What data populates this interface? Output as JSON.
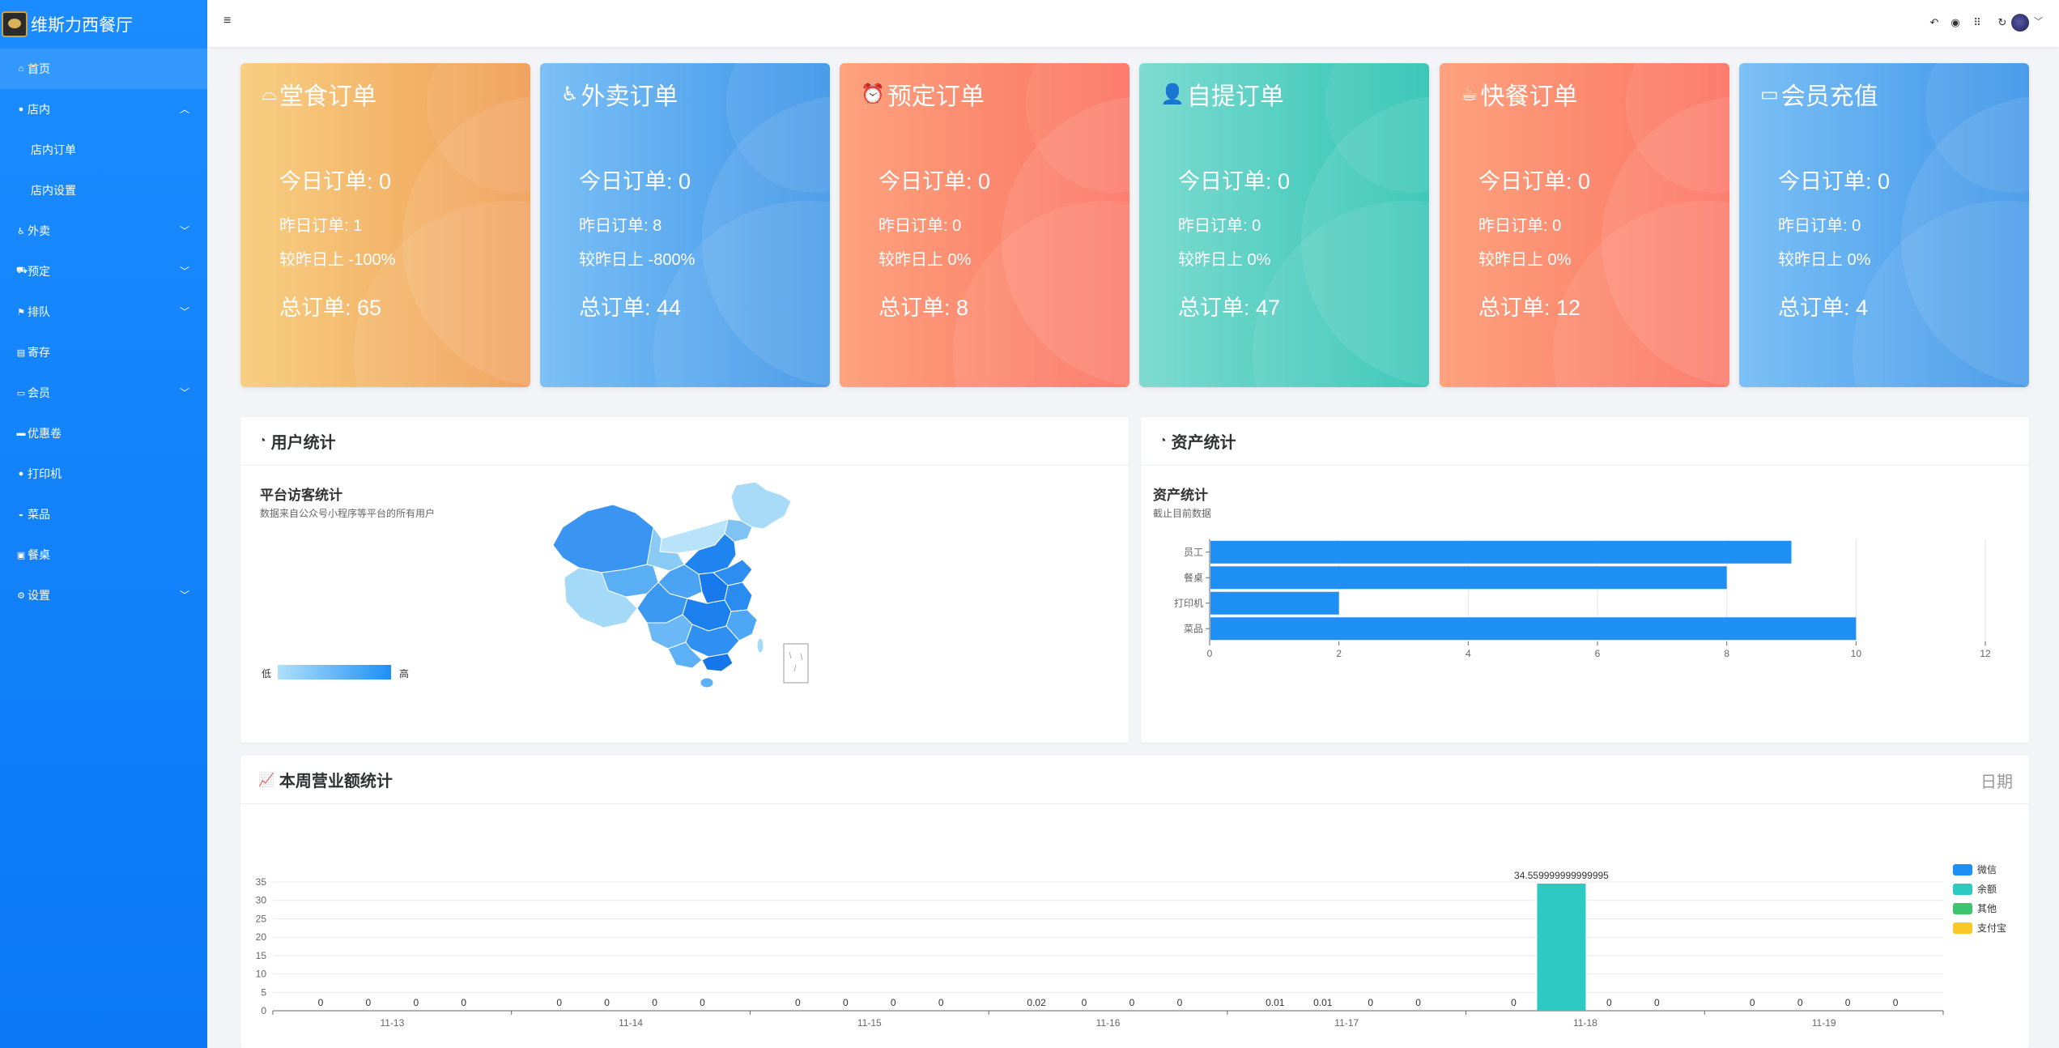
{
  "brand": {
    "title": "维斯力西餐厅"
  },
  "sidebar": {
    "items": [
      {
        "label": "首页",
        "icon": "home-icon",
        "glyph": "⌂",
        "active": true,
        "chev": "",
        "name": "home"
      },
      {
        "label": "店内",
        "icon": "user-icon",
        "glyph": "●",
        "chev": "︿",
        "name": "in-store"
      },
      {
        "label": "店内订单",
        "sub": true,
        "name": "in-store-orders"
      },
      {
        "label": "店内设置",
        "sub": true,
        "name": "in-store-settings"
      },
      {
        "label": "外卖",
        "icon": "bike-icon",
        "glyph": "♿",
        "chev": "﹀",
        "name": "takeout"
      },
      {
        "label": "预定",
        "icon": "cart-icon",
        "glyph": "⛟",
        "chev": "﹀",
        "name": "reserve"
      },
      {
        "label": "排队",
        "icon": "queue-icon",
        "glyph": "⚑",
        "chev": "﹀",
        "name": "queue"
      },
      {
        "label": "寄存",
        "icon": "storage-icon",
        "glyph": "▤",
        "chev": "",
        "name": "storage"
      },
      {
        "label": "会员",
        "icon": "card-icon",
        "glyph": "▭",
        "chev": "﹀",
        "name": "member"
      },
      {
        "label": "优惠卷",
        "icon": "coupon-icon",
        "glyph": "▬",
        "chev": "",
        "name": "coupon"
      },
      {
        "label": "打印机",
        "icon": "printer-icon",
        "glyph": "●",
        "chev": "",
        "name": "printer"
      },
      {
        "label": "菜品",
        "icon": "dish-icon",
        "glyph": "◒",
        "chev": "",
        "name": "dishes"
      },
      {
        "label": "餐桌",
        "icon": "table-icon",
        "glyph": "▣",
        "chev": "",
        "name": "tables"
      },
      {
        "label": "设置",
        "icon": "gear-icon",
        "glyph": "⚙",
        "chev": "﹀",
        "name": "settings"
      }
    ]
  },
  "topbar": {
    "menu_icon": "≡",
    "icons": [
      {
        "name": "back-icon",
        "glyph": "↶"
      },
      {
        "name": "theme-icon",
        "glyph": "◉"
      },
      {
        "name": "apps-icon",
        "glyph": "⠿"
      },
      {
        "name": "refresh-icon",
        "glyph": "↻"
      }
    ],
    "avatar_caret": "﹀"
  },
  "cards": [
    {
      "title": "堂食订单",
      "icon": "dine-in-icon",
      "glyph": "⌓",
      "today": "今日订单: 0",
      "yesterday": "昨日订单: 1",
      "compare": "较昨日上 -100%",
      "total": "总订单: 65",
      "color_from": "#f7cf82",
      "color_to": "#f09d55"
    },
    {
      "title": "外卖订单",
      "icon": "bike-icon",
      "glyph": "♿",
      "today": "今日订单: 0",
      "yesterday": "昨日订单: 8",
      "compare": "较昨日上 -800%",
      "total": "总订单: 44",
      "color_from": "#7cc0f6",
      "color_to": "#3d95e8"
    },
    {
      "title": "预定订单",
      "icon": "alarm-icon",
      "glyph": "⏰",
      "today": "今日订单: 0",
      "yesterday": "昨日订单: 0",
      "compare": "较昨日上 0%",
      "total": "总订单: 8",
      "color_from": "#fda27e",
      "color_to": "#fc7362"
    },
    {
      "title": "自提订单",
      "icon": "person-icon",
      "glyph": "👤",
      "today": "今日订单: 0",
      "yesterday": "昨日订单: 0",
      "compare": "较昨日上 0%",
      "total": "总订单: 47",
      "color_from": "#7fdbd1",
      "color_to": "#2ec3b3"
    },
    {
      "title": "快餐订单",
      "icon": "fastfood-icon",
      "glyph": "☕",
      "today": "今日订单: 0",
      "yesterday": "昨日订单: 0",
      "compare": "较昨日上 0%",
      "total": "总订单: 12",
      "color_from": "#fda27e",
      "color_to": "#fc7362"
    },
    {
      "title": "会员充值",
      "icon": "card-icon",
      "glyph": "▭",
      "today": "今日订单: 0",
      "yesterday": "昨日订单: 0",
      "compare": "较昨日上 0%",
      "total": "总订单: 4",
      "color_from": "#7cc0f6",
      "color_to": "#3d95e8"
    }
  ],
  "user_panel": {
    "title": "用户统计",
    "icon": "chart-icon",
    "glyph": "◔",
    "sub_title": "平台访客统计",
    "sub_desc": "数据来自公众号小程序等平台的所有用户",
    "legend_low": "低",
    "legend_high": "高"
  },
  "asset_panel": {
    "title": "资产统计",
    "icon": "chart-icon",
    "glyph": "◔",
    "sub_title": "资产统计",
    "sub_desc": "截止目前数据"
  },
  "revenue_panel": {
    "title": "本周营业额统计",
    "icon": "area-chart-icon",
    "glyph": "📈",
    "date_label": "日期"
  },
  "chart_data": [
    {
      "type": "bar",
      "orientation": "horizontal",
      "title": "资产统计",
      "subtitle": "截止目前数据",
      "categories": [
        "员工",
        "餐桌",
        "打印机",
        "菜品"
      ],
      "values": [
        9,
        8,
        2,
        10
      ],
      "xlim": [
        0,
        12
      ],
      "xticks": [
        0,
        2,
        4,
        6,
        8,
        10,
        12
      ],
      "color": "#1e8ff5",
      "grid": true
    },
    {
      "type": "bar",
      "title": "本周营业额统计",
      "categories": [
        "11-13",
        "11-14",
        "11-15",
        "11-16",
        "11-17",
        "11-18",
        "11-19"
      ],
      "ylim": [
        0,
        35
      ],
      "yticks": [
        0,
        5,
        10,
        15,
        20,
        25,
        30,
        35
      ],
      "legend_position": "top-right",
      "series": [
        {
          "name": "微信",
          "color": "#1e8ff5",
          "values": [
            0,
            0,
            0,
            0.02,
            0.01,
            0,
            0
          ],
          "labels": [
            "0",
            "0",
            "0",
            "0.02",
            "0.01",
            "0",
            "0"
          ]
        },
        {
          "name": "余额",
          "color": "#2ec9c2",
          "values": [
            0,
            0,
            0,
            0,
            0.01,
            34.559999999999995,
            0
          ],
          "labels": [
            "0",
            "0",
            "0",
            "0",
            "0.01",
            "34.559999999999995",
            "0"
          ]
        },
        {
          "name": "其他",
          "color": "#3fc46e",
          "values": [
            0,
            0,
            0,
            0,
            0,
            0,
            0
          ],
          "labels": [
            "0",
            "0",
            "0",
            "0",
            "0",
            "0",
            "0"
          ]
        },
        {
          "name": "支付宝",
          "color": "#f9c928",
          "values": [
            0,
            0,
            0,
            0,
            0,
            0,
            0
          ],
          "labels": [
            "0",
            "0",
            "0",
            "0",
            "0",
            "0",
            "0"
          ]
        }
      ]
    }
  ]
}
